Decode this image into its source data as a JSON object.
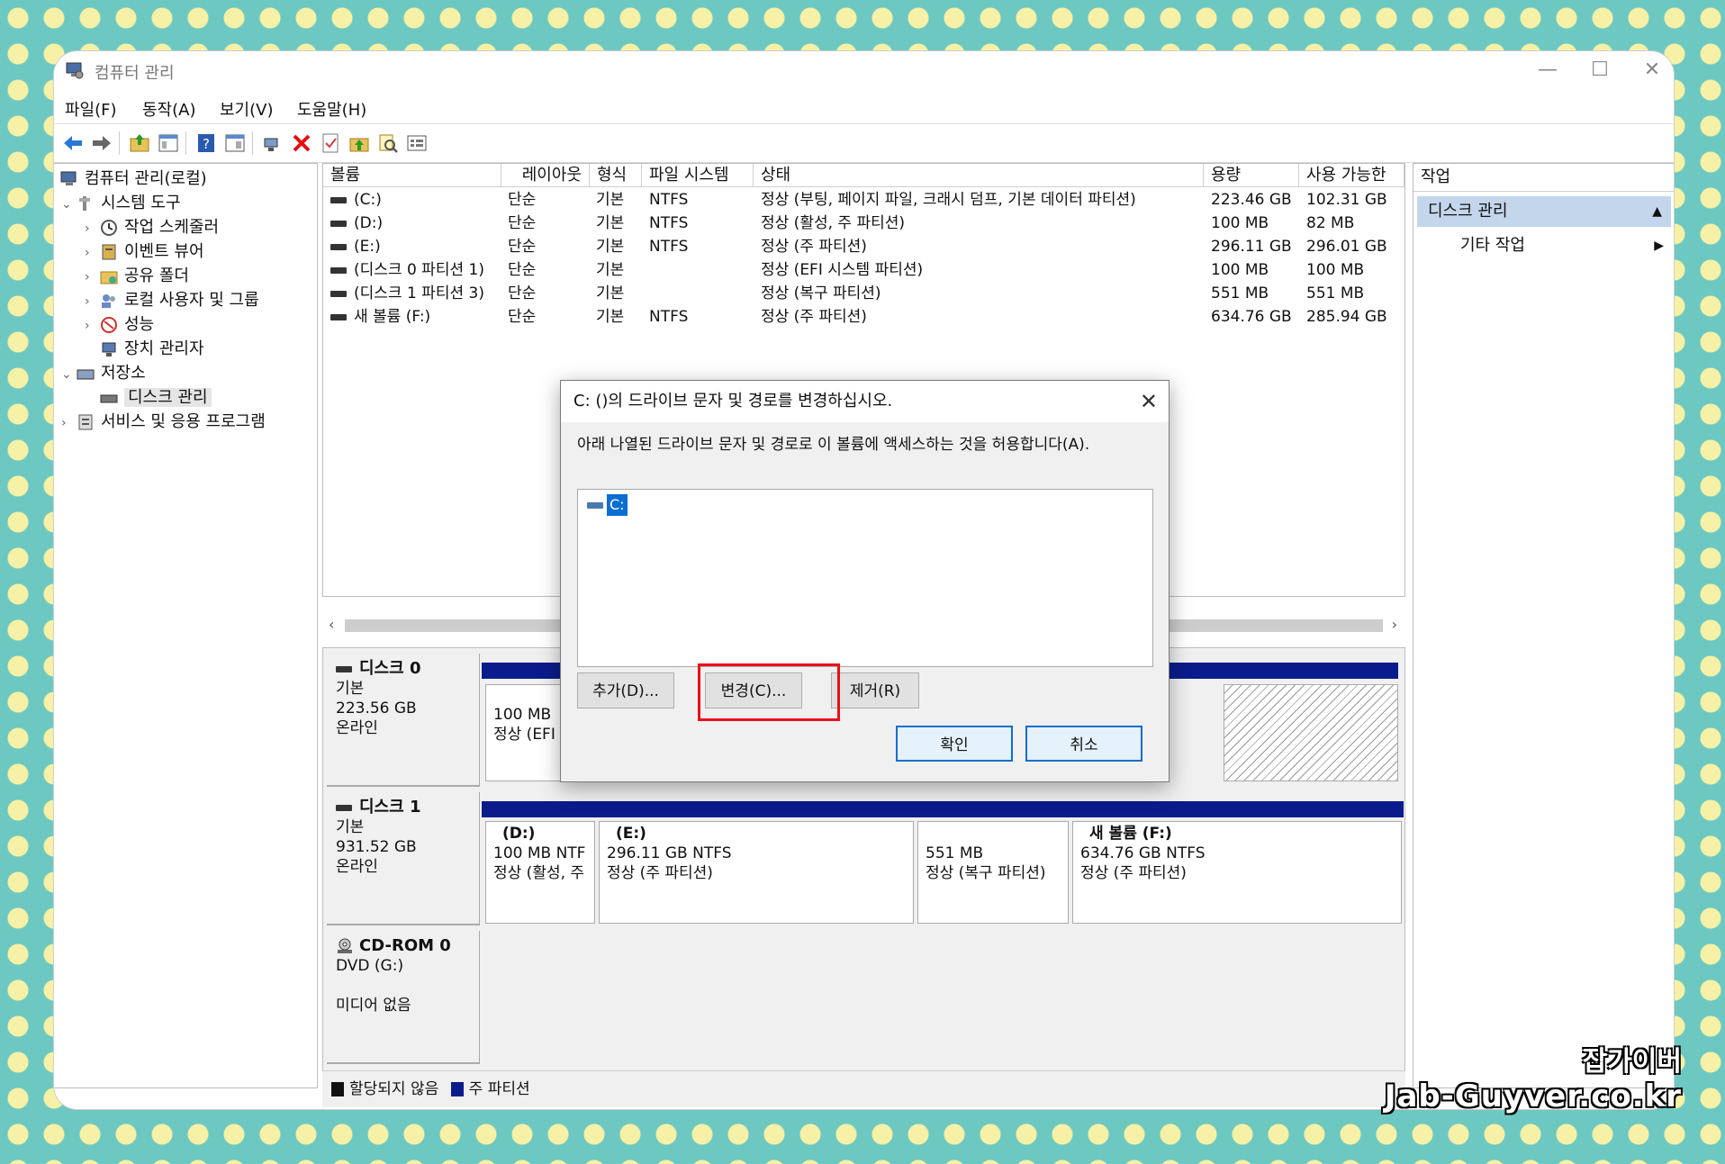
{
  "window": {
    "title": "컴퓨터 관리",
    "controls": {
      "minimize": "—",
      "maximize": "☐",
      "close": "✕"
    }
  },
  "menubar": [
    "파일(F)",
    "동작(A)",
    "보기(V)",
    "도움말(H)"
  ],
  "toolbar_icons": [
    "back-icon",
    "forward-icon",
    "up-folder-icon",
    "show-tree-icon",
    "help-icon",
    "properties-view-icon",
    "connect-icon",
    "delete-icon",
    "check-icon",
    "import-icon",
    "search-icon",
    "list-icon"
  ],
  "tree": {
    "root": "컴퓨터 관리(로컬)",
    "items": [
      {
        "label": "시스템 도구",
        "level": 1,
        "expander": "⌄"
      },
      {
        "label": "작업 스케줄러",
        "level": 2,
        "expander": "›"
      },
      {
        "label": "이벤트 뷰어",
        "level": 2,
        "expander": "›"
      },
      {
        "label": "공유 폴더",
        "level": 2,
        "expander": "›"
      },
      {
        "label": "로컬 사용자 및 그룹",
        "level": 2,
        "expander": "›"
      },
      {
        "label": "성능",
        "level": 2,
        "expander": "›"
      },
      {
        "label": "장치 관리자",
        "level": 2,
        "expander": ""
      },
      {
        "label": "저장소",
        "level": 1,
        "expander": "⌄"
      },
      {
        "label": "디스크 관리",
        "level": 2,
        "expander": "",
        "selected": true
      },
      {
        "label": "서비스 및 응용 프로그램",
        "level": 1,
        "expander": "›"
      }
    ]
  },
  "volume_list": {
    "columns": [
      "볼륨",
      "레이아웃",
      "형식",
      "파일 시스템",
      "상태",
      "용량",
      "사용 가능한"
    ],
    "rows": [
      [
        "(C:)",
        "단순",
        "기본",
        "NTFS",
        "정상 (부팅, 페이지 파일, 크래시 덤프, 기본 데이터 파티션)",
        "223.46 GB",
        "102.31 GB"
      ],
      [
        "(D:)",
        "단순",
        "기본",
        "NTFS",
        "정상 (활성, 주 파티션)",
        "100 MB",
        "82 MB"
      ],
      [
        "(E:)",
        "단순",
        "기본",
        "NTFS",
        "정상 (주 파티션)",
        "296.11 GB",
        "296.01 GB"
      ],
      [
        "(디스크 0 파티션 1)",
        "단순",
        "기본",
        "",
        "정상 (EFI 시스템 파티션)",
        "100 MB",
        "100 MB"
      ],
      [
        "(디스크 1 파티션 3)",
        "단순",
        "기본",
        "",
        "정상 (복구 파티션)",
        "551 MB",
        "551 MB"
      ],
      [
        "새 볼륨 (F:)",
        "단순",
        "기본",
        "NTFS",
        "정상 (주 파티션)",
        "634.76 GB",
        "285.94 GB"
      ]
    ]
  },
  "disks": [
    {
      "name": "디스크 0",
      "type": "기본",
      "size": "223.56 GB",
      "status": "온라인",
      "partitions": [
        {
          "line1": "100 MB",
          "line2": "정상 (EFI"
        }
      ]
    },
    {
      "name": "디스크 1",
      "type": "기본",
      "size": "931.52 GB",
      "status": "온라인",
      "partitions": [
        {
          "line0": "(D:)",
          "line1": "100 MB NTF",
          "line2": "정상 (활성, 주"
        },
        {
          "line0": "(E:)",
          "line1": "296.11 GB NTFS",
          "line2": "정상 (주 파티션)"
        },
        {
          "line1": "551 MB",
          "line2": "정상 (복구 파티션)"
        },
        {
          "line0": "새 볼륨 (F:)",
          "line1": "634.76 GB NTFS",
          "line2": "정상 (주 파티션)"
        }
      ]
    },
    {
      "name": "CD-ROM 0",
      "type": "DVD (G:)",
      "status": "미디어 없음"
    }
  ],
  "legend": [
    {
      "label": "할당되지 않음",
      "color": "#111111"
    },
    {
      "label": "주 파티션",
      "color": "#0a1c8c"
    }
  ],
  "actions": {
    "header": "작업",
    "section": "디스크 관리",
    "section_arrow": "▲",
    "sub": "기타 작업",
    "sub_arrow": "▶"
  },
  "dialog": {
    "title": "C: ()의 드라이브 문자 및 경로를 변경하십시오.",
    "close": "✕",
    "description": "아래 나열된 드라이브 문자 및 경로로 이 볼륨에 액세스하는 것을 허용합니다(A).",
    "list_items": [
      "C:"
    ],
    "buttons": {
      "add": "추가(D)...",
      "change": "변경(C)...",
      "remove": "제거(R)",
      "ok": "확인",
      "cancel": "취소"
    }
  },
  "watermark": {
    "line1": "잡가이버",
    "line2": "Jab-Guyver.co.kr"
  }
}
